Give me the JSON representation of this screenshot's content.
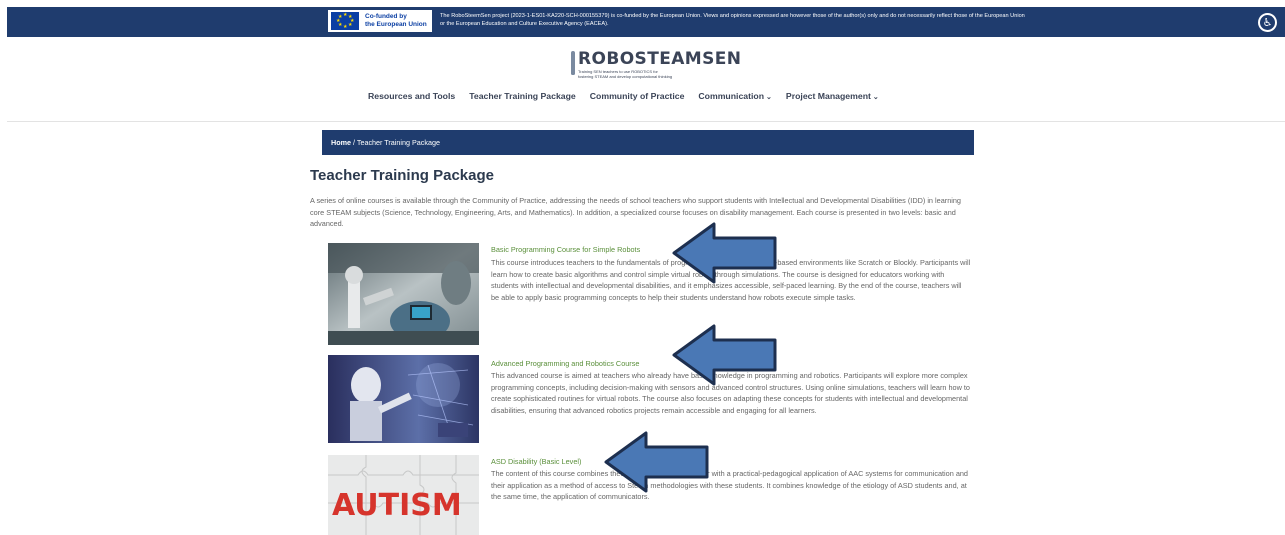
{
  "banner": {
    "eu_logo_line1": "Co-funded by",
    "eu_logo_line2": "the European Union",
    "disclaimer": "The RoboSteemSen project (2023-1-ES01-KA220-SCH-000155379) is co-funded by the European Union. Views and opinions expressed are however those of the author(s) only and do not necessarily reflect those of the European Union or the European Education and Culture Executive Agency (EACEA).",
    "accessibility_icon": "accessibility-icon"
  },
  "site": {
    "logo_main": "ROBOSTEAMSEN",
    "logo_sub": "Training SEN teachers to use ROBOTICS for fostering STEAM and develop computational thinking"
  },
  "nav": {
    "items": [
      {
        "label": "Resources and Tools"
      },
      {
        "label": "Teacher Training Package"
      },
      {
        "label": "Community of Practice"
      },
      {
        "label": "Communication",
        "caret": "⌄"
      },
      {
        "label": "Project Management",
        "caret": "⌄"
      }
    ]
  },
  "breadcrumb": {
    "home": "Home",
    "separator": " / ",
    "current": "Teacher Training Package"
  },
  "page": {
    "title": "Teacher Training Package",
    "intro": "A series of online courses is available through the Community of Practice, addressing the needs of school teachers who support students with Intellectual and Developmental Disabilities (IDD) in learning core STEAM subjects (Science, Technology, Engineering, Arts, and Mathematics). In addition, a specialized course focuses on disability management. Each course is presented in two levels: basic and advanced."
  },
  "courses": [
    {
      "title": "Basic Programming Course for Simple Robots",
      "description": "This course introduces teachers to the fundamentals of programming using visual, block-based environments like Scratch or Blockly. Participants will learn how to create basic algorithms and control simple virtual robots through simulations. The course is designed for educators working with students with intellectual and developmental disabilities, and it emphasizes accessible, self-paced learning. By the end of the course, teachers will be able to apply basic programming concepts to help their students understand how robots execute simple tasks."
    },
    {
      "title": "Advanced Programming and Robotics Course",
      "description": "This advanced course is aimed at teachers who already have basic knowledge in programming and robotics. Participants will explore more complex programming concepts, including decision-making with sensors and advanced control structures. Using online simulations, teachers will learn how to create sophisticated routines for virtual robots. The course also focuses on adapting these concepts for students with intellectual and developmental disabilities, ensuring that advanced robotics projects remain accessible and engaging for all learners."
    },
    {
      "title": "ASD Disability (Basic Level)",
      "description": "The content of this course combines theoretical knowledge together with a practical-pedagogical application of AAC systems for communication and their application as a method of access to Steam methodologies with these students. It combines knowledge of the etiology of ASD students and, at the same time, the application of communicators.",
      "thumb_text": "AUTISM"
    }
  ],
  "colors": {
    "navy": "#1f3c6e",
    "course_title": "#5a8f3a",
    "arrow_fill": "#4a78b5",
    "arrow_stroke": "#1d2f4f"
  }
}
